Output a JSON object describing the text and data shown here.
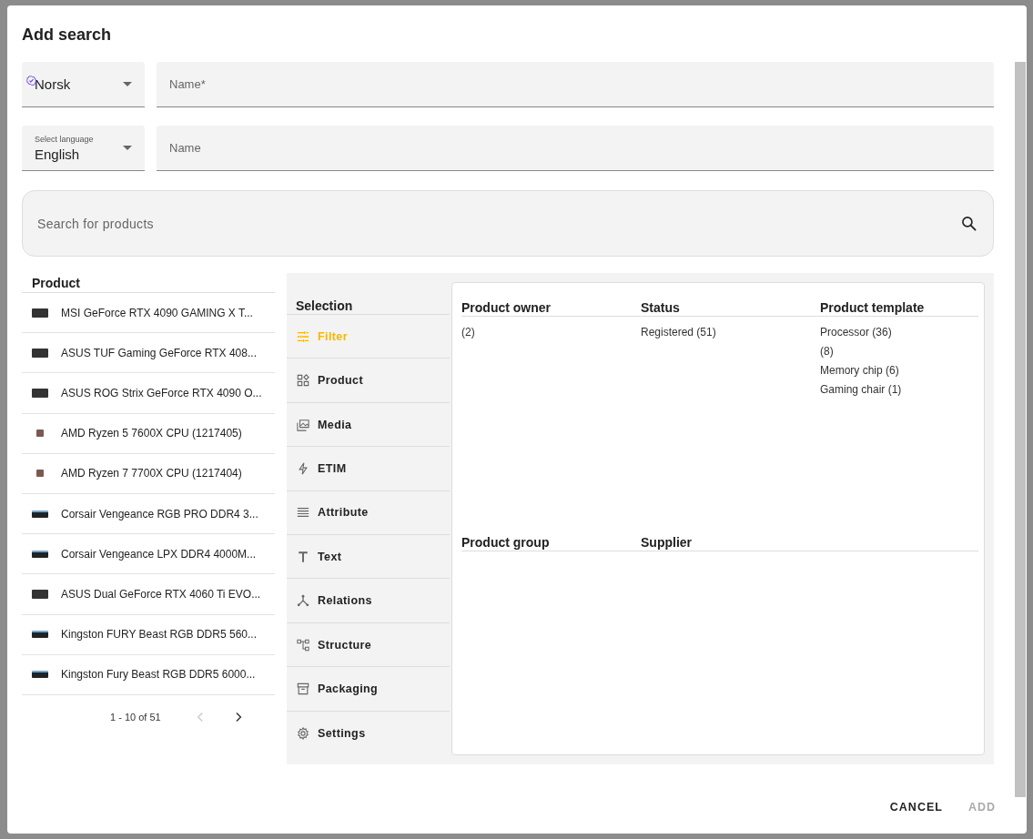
{
  "dialog": {
    "title": "Add search"
  },
  "fields": [
    {
      "kind": "select",
      "value": "Norsk",
      "verified": true
    },
    {
      "kind": "text",
      "placeholder": "Name*"
    },
    {
      "kind": "select",
      "label": "Select language",
      "value": "English",
      "verified": false
    },
    {
      "kind": "text",
      "placeholder": "Name"
    }
  ],
  "search": {
    "placeholder": "Search for products"
  },
  "product_list": {
    "heading": "Product",
    "items": [
      {
        "name": "MSI GeForce RTX 4090 GAMING X T..."
      },
      {
        "name": "ASUS TUF Gaming GeForce RTX 408..."
      },
      {
        "name": "ASUS ROG Strix GeForce RTX 4090 O..."
      },
      {
        "name": "AMD Ryzen 5 7600X CPU  (1217405)"
      },
      {
        "name": "AMD Ryzen 7 7700X CPU  (1217404)"
      },
      {
        "name": "Corsair Vengeance RGB PRO DDR4 3..."
      },
      {
        "name": "Corsair Vengeance LPX DDR4 4000M..."
      },
      {
        "name": "ASUS Dual GeForce RTX 4060 Ti EVO..."
      },
      {
        "name": "Kingston FURY Beast RGB DDR5 560..."
      },
      {
        "name": "Kingston Fury Beast RGB DDR5 6000..."
      }
    ],
    "pagination": {
      "range": "1 - 10 of 51",
      "prev_disabled": true,
      "next_disabled": false
    }
  },
  "selection": {
    "heading": "Selection",
    "tabs": [
      {
        "label": "Filter",
        "selected": true
      },
      {
        "label": "Product",
        "selected": false
      },
      {
        "label": "Media",
        "selected": false
      },
      {
        "label": "ETIM",
        "selected": false
      },
      {
        "label": "Attribute",
        "selected": false
      },
      {
        "label": "Text",
        "selected": false
      },
      {
        "label": "Relations",
        "selected": false
      },
      {
        "label": "Structure",
        "selected": false
      },
      {
        "label": "Packaging",
        "selected": false
      },
      {
        "label": "Settings",
        "selected": false
      }
    ]
  },
  "filter_groups": [
    {
      "title": "Product owner",
      "values": [
        " (2)"
      ]
    },
    {
      "title": "Status",
      "values": [
        "Registered (51)"
      ]
    },
    {
      "title": "Product template",
      "values": [
        "Processor (36)",
        " (8)",
        "Memory chip (6)",
        "Gaming chair (1)"
      ]
    },
    {
      "title": "Product group"
    },
    {
      "title": "Supplier"
    }
  ],
  "buttons": [
    {
      "label": "CANCEL",
      "disabled": false
    },
    {
      "label": "ADD",
      "disabled": true
    }
  ]
}
